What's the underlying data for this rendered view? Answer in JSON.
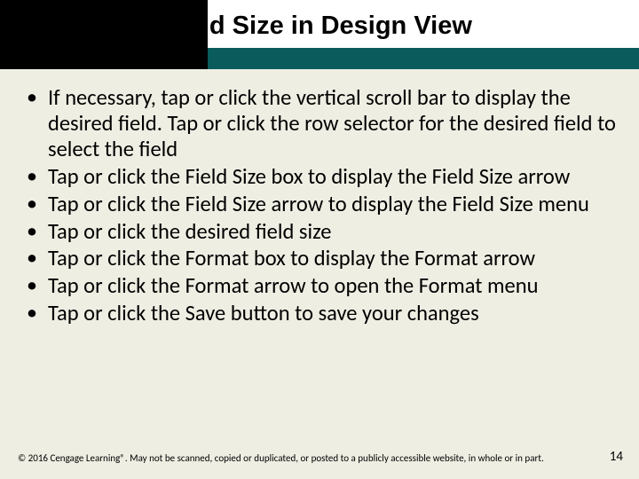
{
  "title": "Changing a Field Size in Design View",
  "bullets": [
    "If necessary, tap or click the vertical scroll bar to display the desired field. Tap or click the row selector for the desired field to select the field",
    "Tap or click the Field Size box to display the Field Size arrow",
    "Tap or click the Field Size arrow to display the Field Size menu",
    "Tap or click the desired field size",
    "Tap or click the Format box to display the Format arrow",
    "Tap or click the Format arrow to open the Format menu",
    "Tap or click the Save button to save your changes"
  ],
  "footer": {
    "copyright": "© 2016 Cengage Learning®. May not be scanned, copied or duplicated, or posted to a publicly accessible website, in whole or in part.",
    "page": "14"
  }
}
